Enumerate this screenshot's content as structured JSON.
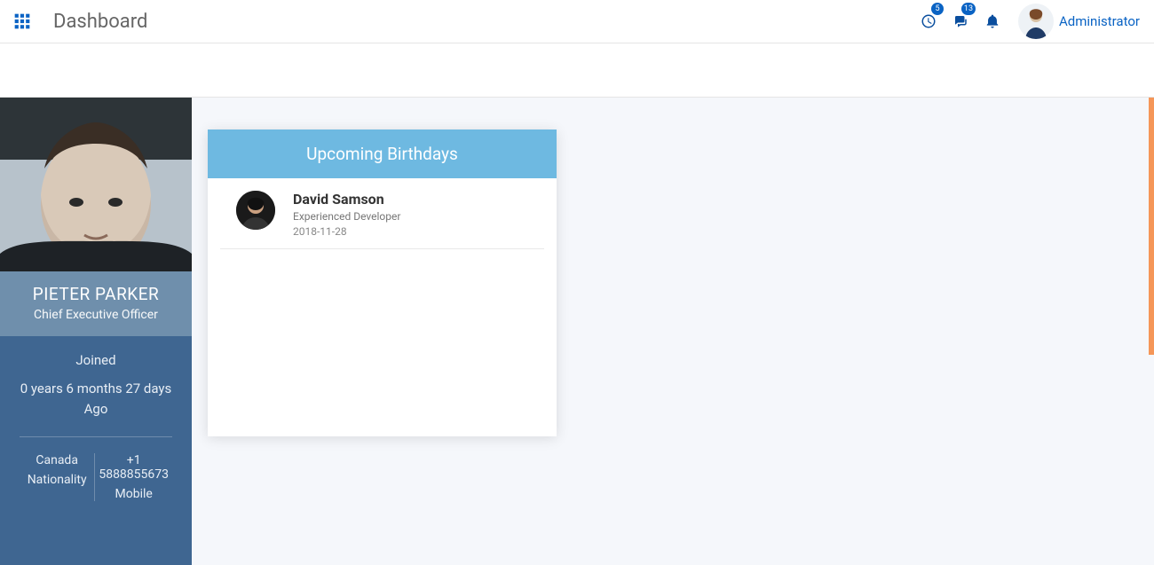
{
  "header": {
    "page_title": "Dashboard",
    "clock_badge": "5",
    "chat_badge": "13",
    "user_label": "Administrator"
  },
  "profile": {
    "name": "PIETER PARKER",
    "title": "Chief Executive Officer",
    "joined_label": "Joined",
    "joined_duration": "0 years 6 months 27 days Ago",
    "nationality_value": "Canada",
    "nationality_label": "Nationality",
    "mobile_value": "+1 5888855673",
    "mobile_label": "Mobile"
  },
  "card": {
    "title": "Upcoming Birthdays",
    "items": [
      {
        "name": "David Samson",
        "role": "Experienced Developer",
        "date": "2018-11-28"
      }
    ]
  }
}
